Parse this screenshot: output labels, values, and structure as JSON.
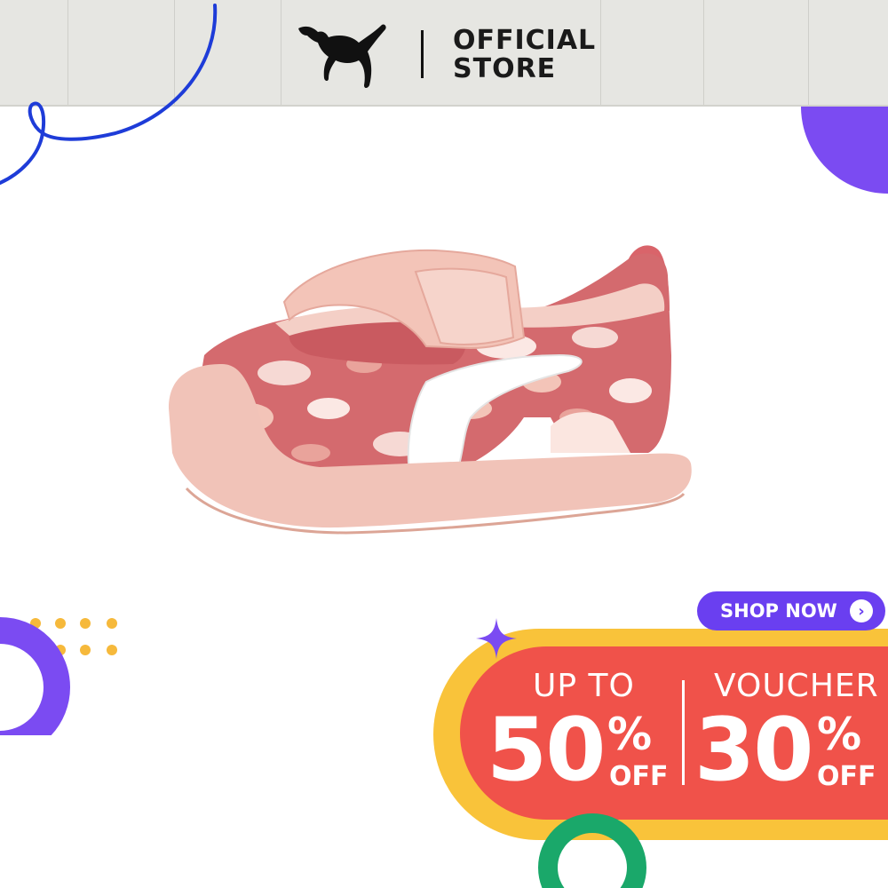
{
  "brand": {
    "logo_name": "puma-cat-logo",
    "store_line1": "OFFICIAL",
    "store_line2": "STORE"
  },
  "shop_button": {
    "label": "SHOP NOW",
    "icon": "chevron-right-icon"
  },
  "promo_left": {
    "label": "UP TO",
    "value": "50",
    "percent": "%",
    "suffix": "OFF"
  },
  "promo_right": {
    "label": "VOUCHER",
    "value": "30",
    "percent": "%",
    "suffix": "OFF"
  },
  "colors": {
    "header_bg": "#e6e6e2",
    "purple": "#6a3ff0",
    "blue_line": "#1e3cd8",
    "yellow": "#f9c33a",
    "red": "#f0524a",
    "green": "#1aa86a",
    "shoe_pink": "#f3c4b8",
    "shoe_rose": "#d9646a"
  }
}
